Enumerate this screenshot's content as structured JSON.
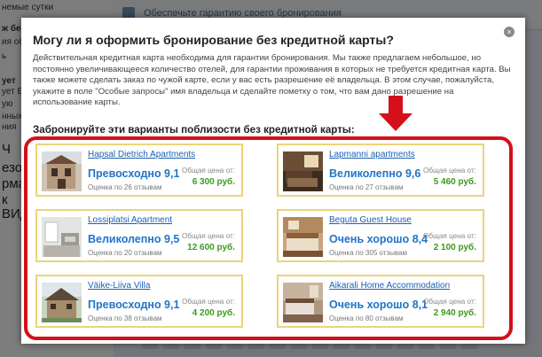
{
  "background": {
    "left_fragments": [
      "немые сутки",
      "ж бесплатно",
      "ия обслуж",
      "ь",
      "ует",
      "ует Вы",
      "ую",
      "нных",
      "ния",
      "Ч",
      "езо",
      "рма",
      "к",
      "ВИД"
    ],
    "topbar_text": "Обеспечьте гарантию своего бронирования"
  },
  "modal": {
    "close_label": "×",
    "title": "Могу ли я оформить бронирование без кредитной карты?",
    "description": "Действительная кредитная карта необходима для гарантии бронирования. Мы также предлагаем небольшое, но постоянно увеличивающееся количество отелей, для гарантии проживания в которых не требуется кредитная карта. Вы также можете сделать заказ по чужой карте, если у вас есть разрешение её владельца. В этом случае, пожалуйста, укажите в поле \"Особые запросы\" имя владельца и сделайте пометку о том, что вам дано разрешение на использование карты.",
    "section_title": "Забронируйте эти варианты поблизости без кредитной карты:",
    "accent_color": "#d4101a",
    "hotels": [
      {
        "name": "Hapsal Dietrich Apartments",
        "score": "Превосходно 9,1",
        "reviews": "Оценка по 26 отзывам",
        "price_label": "Общая цена от:",
        "price": "6 300 руб.",
        "thumb_icon": "building-photo"
      },
      {
        "name": "Lapmanni apartments",
        "score": "Великолепно 9,6",
        "reviews": "Оценка по 27 отзывам",
        "price_label": "Общая цена от:",
        "price": "5 460 руб.",
        "thumb_icon": "room-photo"
      },
      {
        "name": "Lossiplatsi Apartment",
        "score": "Великолепно 9,5",
        "reviews": "Оценка по 20 отзывам",
        "price_label": "Общая цена от:",
        "price": "12 600 руб.",
        "thumb_icon": "interior-photo"
      },
      {
        "name": "Beguta Guest House",
        "score": "Очень хорошо 8,4",
        "reviews": "Оценка по 305 отзывам",
        "price_label": "Общая цена от:",
        "price": "2 100 руб.",
        "thumb_icon": "bedroom-photo"
      },
      {
        "name": "Väike-Liiva Villa",
        "score": "Превосходно 9,1",
        "reviews": "Оценка по 38 отзывам",
        "price_label": "Общая цена от:",
        "price": "4 200 руб.",
        "thumb_icon": "villa-photo"
      },
      {
        "name": "Aikarali Home Accommodation",
        "score": "Очень хорошо 8,1",
        "reviews": "Оценка по 80 отзывам",
        "price_label": "Общая цена от:",
        "price": "2 940 руб.",
        "thumb_icon": "bedroom-photo"
      }
    ]
  }
}
